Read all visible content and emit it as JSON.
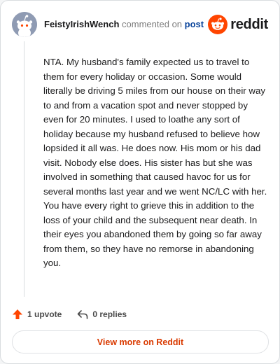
{
  "header": {
    "username": "FeistyIrishWench",
    "verb": "commented on",
    "post_link": "post",
    "logo_text": "reddit"
  },
  "comment": {
    "text": "NTA. My husband's family expected us to travel to them for every holiday or occasion. Some would literally be driving 5 miles from our house on their way to and from a vacation spot and never stopped by even for 20 minutes. I used to loathe any sort of holiday because my husband refused to believe how lopsided it all was. He does now. His mom or his dad visit. Nobody else does. His sister has but she was involved in something that caused havoc for us for several months last year and we went NC/LC with her. You have every right to grieve this in addition to the loss of your child and the subsequent near death. In their eyes you abandoned them by going so far away from them, so they have no remorse in abandoning you."
  },
  "actions": {
    "upvote_label": "1 upvote",
    "replies_label": "0 replies"
  },
  "footer": {
    "view_more_label": "View more on Reddit"
  },
  "colors": {
    "accent": "#ff4500",
    "link": "#0a449b",
    "cta_text": "#d93a00"
  },
  "icons": {
    "avatar": "reddit-snoo-avatar",
    "logo": "reddit-logo-icon",
    "upvote": "upvote-arrow-icon",
    "reply": "reply-arrow-icon"
  }
}
